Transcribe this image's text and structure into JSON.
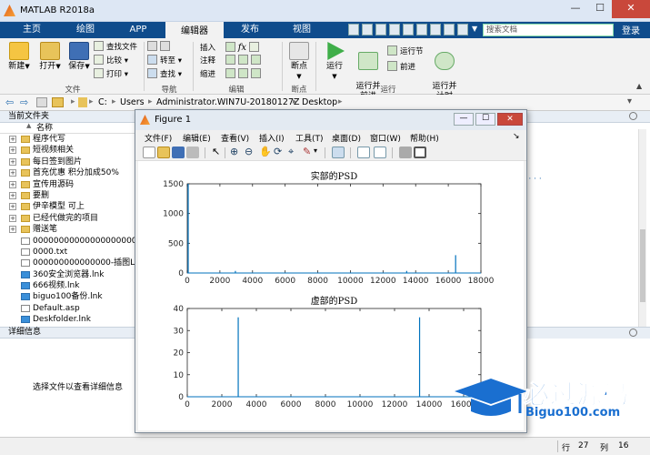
{
  "window": {
    "title": "MATLAB R2018a",
    "min": "—",
    "max": "☐",
    "close": "✕"
  },
  "tabs": [
    {
      "label": "主页"
    },
    {
      "label": "绘图"
    },
    {
      "label": "APP"
    },
    {
      "label": "编辑器",
      "active": true
    },
    {
      "label": "发布"
    },
    {
      "label": "视图"
    }
  ],
  "search": {
    "placeholder": "搜索文档"
  },
  "login": "登录",
  "ribbon": {
    "file": {
      "new": "新建",
      "open": "打开",
      "save": "保存",
      "find_files": "查找文件",
      "compare": "比较",
      "print": "打印",
      "group": "文件"
    },
    "nav": {
      "goto": "转至",
      "find": "查找",
      "group": "导航"
    },
    "edit": {
      "insert": "插入",
      "comment": "注释",
      "indent": "缩进",
      "fx": "fx",
      "group": "编辑"
    },
    "breakpoints": {
      "label": "断点",
      "group": "断点"
    },
    "run": {
      "run": "运行",
      "run_advance": "运行并\n前进",
      "run_section": "运行节",
      "advance": "前进",
      "run_time": "运行并\n计时",
      "group": "运行"
    }
  },
  "address": {
    "parts": [
      "C:",
      "Users",
      "Administrator.WIN7U-20180127Z",
      "Desktop"
    ]
  },
  "current_folder": {
    "title": "当前文件夹",
    "col_name": "名称",
    "sort": "▲",
    "items": [
      {
        "name": "程序代写",
        "type": "folder"
      },
      {
        "name": "短视频相关",
        "type": "folder"
      },
      {
        "name": "每日签到图片",
        "type": "folder"
      },
      {
        "name": "首充优惠 积分加成50%",
        "type": "folder"
      },
      {
        "name": "宣传用源码",
        "type": "folder"
      },
      {
        "name": "要删",
        "type": "folder"
      },
      {
        "name": "伊辛模型 可上",
        "type": "folder"
      },
      {
        "name": "已经代做完的项目",
        "type": "folder"
      },
      {
        "name": "赠送笔",
        "type": "folder"
      },
      {
        "name": "000000000000000000000...",
        "type": "file"
      },
      {
        "name": "0000.txt",
        "type": "file"
      },
      {
        "name": "000000000000000-插图L...",
        "type": "file"
      },
      {
        "name": "360安全浏览器.lnk",
        "type": "lnk"
      },
      {
        "name": "666视频.lnk",
        "type": "lnk"
      },
      {
        "name": "biguo100备份.lnk",
        "type": "lnk"
      },
      {
        "name": "Default.asp",
        "type": "file"
      },
      {
        "name": "Deskfolder.lnk",
        "type": "lnk"
      }
    ]
  },
  "details": {
    "title": "详细信息",
    "hint": "选择文件以查看详细信息"
  },
  "right_panel": {
    "ellipsis": ") · · ·"
  },
  "status": {
    "row_label": "行",
    "row": "27",
    "col_label": "列",
    "col": "16"
  },
  "figure": {
    "title": "Figure 1",
    "menus": [
      "文件(F)",
      "编辑(E)",
      "查看(V)",
      "插入(I)",
      "工具(T)",
      "桌面(D)",
      "窗口(W)",
      "帮助(H)"
    ],
    "dock_arrow": "↘"
  },
  "watermark": {
    "text": "必过源码",
    "url": "Biguo100.com"
  },
  "chart_data": [
    {
      "type": "line",
      "title": "实部的PSD",
      "xlabel": "",
      "ylabel": "",
      "xlim": [
        0,
        18000
      ],
      "ylim": [
        0,
        1500
      ],
      "xticks": [
        0,
        2000,
        4000,
        6000,
        8000,
        10000,
        12000,
        14000,
        16000,
        18000
      ],
      "yticks": [
        0,
        500,
        1000,
        1500
      ],
      "color": "#0072bd",
      "spikes": [
        [
          0,
          1500
        ],
        [
          2950,
          35
        ],
        [
          13450,
          35
        ],
        [
          16450,
          300
        ]
      ]
    },
    {
      "type": "line",
      "title": "虚部的PSD",
      "xlabel": "",
      "ylabel": "",
      "xlim": [
        0,
        17000
      ],
      "ylim": [
        0,
        40
      ],
      "xticks": [
        0,
        2000,
        4000,
        6000,
        8000,
        10000,
        12000,
        14000,
        16000
      ],
      "yticks": [
        0,
        10,
        20,
        30,
        40
      ],
      "color": "#0072bd",
      "spikes": [
        [
          2950,
          36
        ],
        [
          13450,
          36
        ]
      ]
    }
  ]
}
